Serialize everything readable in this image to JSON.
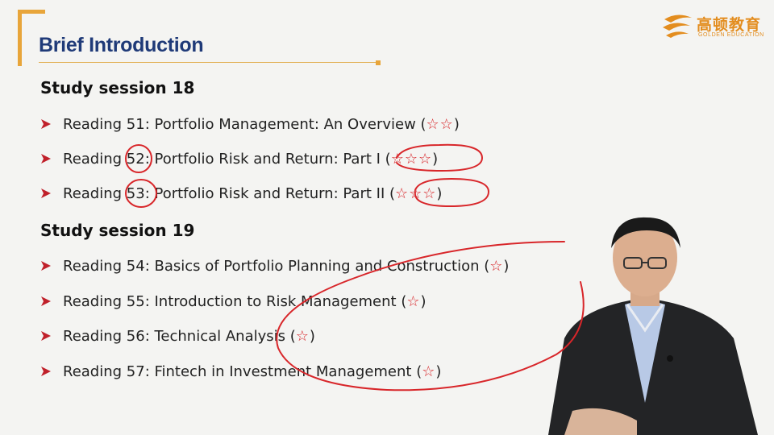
{
  "slide": {
    "title": "Brief Introduction",
    "logo": {
      "cn": "高顿教育",
      "en": "GOLDEN EDUCATION"
    },
    "sessions": [
      {
        "heading": "Study session 18",
        "items": [
          {
            "text": "Reading 51: Portfolio Management: An Overview (",
            "stars": "☆☆",
            "close": ")"
          },
          {
            "text": "Reading 52: Portfolio Risk and Return: Part I (",
            "stars": "☆☆☆",
            "close": ")"
          },
          {
            "text": "Reading 53: Portfolio Risk and Return: Part II (",
            "stars": "☆☆☆",
            "close": ")"
          }
        ]
      },
      {
        "heading": "Study session 19",
        "items": [
          {
            "text": "Reading 54: Basics of Portfolio Planning and Construction (",
            "stars": "☆",
            "close": ")"
          },
          {
            "text": "Reading 55: Introduction to Risk Management (",
            "stars": "☆",
            "close": ")"
          },
          {
            "text": "Reading 56: Technical Analysis (",
            "stars": "☆",
            "close": ")"
          },
          {
            "text": "Reading 57: Fintech in Investment Management (",
            "stars": "☆",
            "close": ")"
          }
        ]
      }
    ]
  },
  "colors": {
    "title": "#1f3a78",
    "accent": "#e8a53a",
    "star": "#d8262a",
    "annotation": "#d8262a"
  }
}
